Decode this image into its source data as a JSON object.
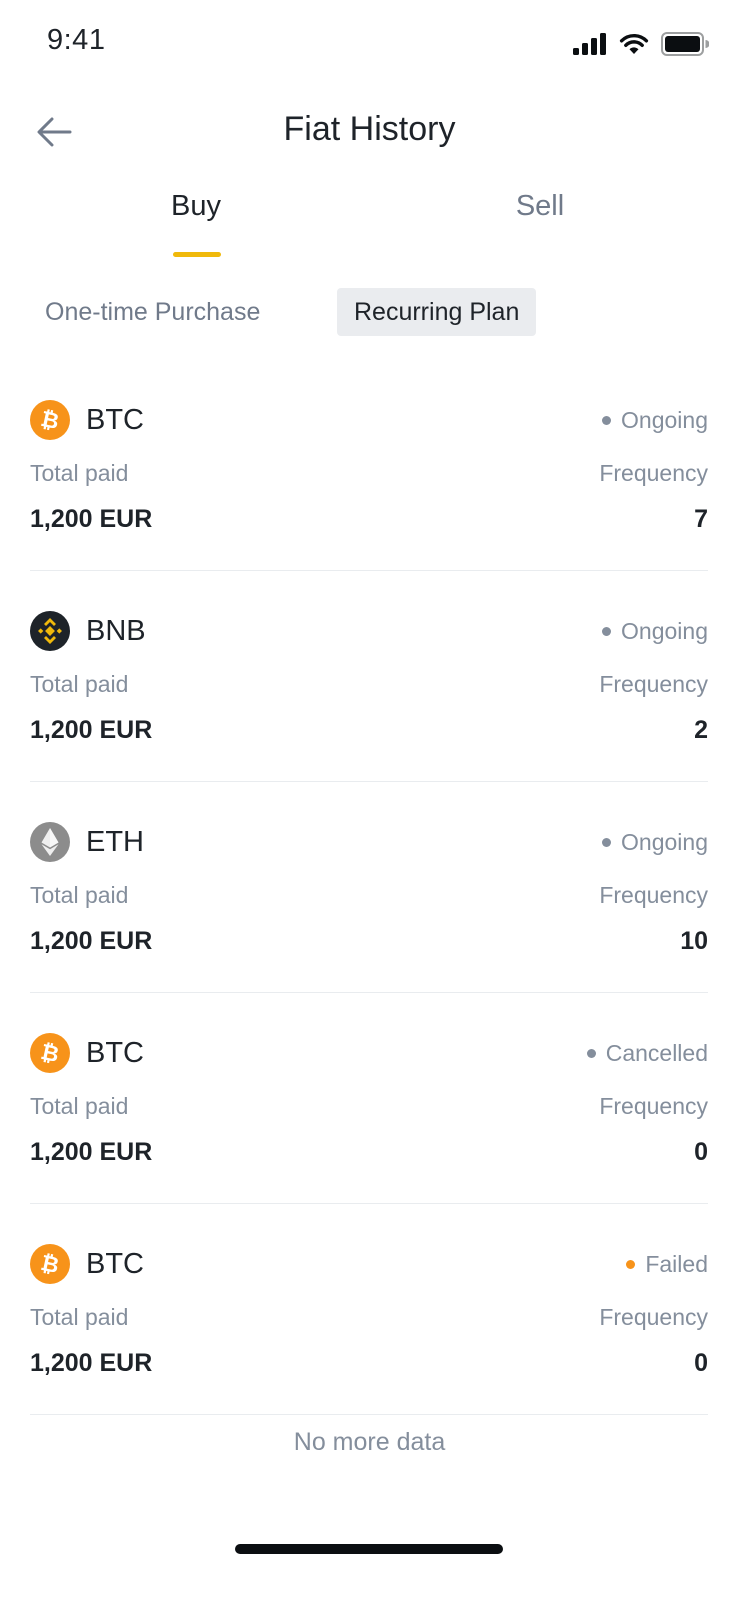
{
  "status_bar": {
    "time": "9:41"
  },
  "header": {
    "title": "Fiat History"
  },
  "tabs": [
    {
      "label": "Buy",
      "active": true
    },
    {
      "label": "Sell",
      "active": false
    }
  ],
  "subtabs": [
    {
      "label": "One-time Purchase",
      "active": false
    },
    {
      "label": "Recurring Plan",
      "active": true
    }
  ],
  "plans": [
    {
      "coin": "BTC",
      "icon": "btc-icon",
      "status": "Ongoing",
      "status_color": "#848e9c",
      "total_label": "Total paid",
      "total": "1,200 EUR",
      "frequency_label": "Frequency",
      "frequency": "7"
    },
    {
      "coin": "BNB",
      "icon": "bnb-icon",
      "status": "Ongoing",
      "status_color": "#848e9c",
      "total_label": "Total paid",
      "total": "1,200 EUR",
      "frequency_label": "Frequency",
      "frequency": "2"
    },
    {
      "coin": "ETH",
      "icon": "eth-icon",
      "status": "Ongoing",
      "status_color": "#848e9c",
      "total_label": "Total paid",
      "total": "1,200 EUR",
      "frequency_label": "Frequency",
      "frequency": "10"
    },
    {
      "coin": "BTC",
      "icon": "btc-icon",
      "status": "Cancelled",
      "status_color": "#848e9c",
      "total_label": "Total paid",
      "total": "1,200 EUR",
      "frequency_label": "Frequency",
      "frequency": "0"
    },
    {
      "coin": "BTC",
      "icon": "btc-icon",
      "status": "Failed",
      "status_color": "#f7931a",
      "total_label": "Total paid",
      "total": "1,200 EUR",
      "frequency_label": "Frequency",
      "frequency": "0"
    }
  ],
  "footer": {
    "no_more": "No more data"
  },
  "colors": {
    "accent": "#f0b90b",
    "btc": "#f7931a",
    "bnb": "#1e2329",
    "eth": "#8c8c8c"
  }
}
